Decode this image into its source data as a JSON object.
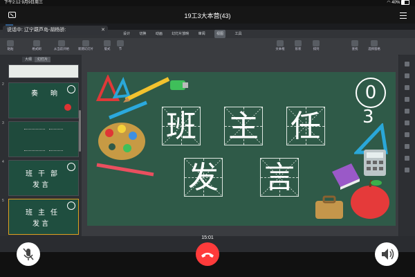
{
  "status_bar": {
    "time": "下午2:12",
    "date": "9月9日周三",
    "battery": "40%"
  },
  "call": {
    "title": "19工3大本营",
    "participants": "(43)",
    "timer": "15:01"
  },
  "speaker": {
    "label": "说话中:",
    "name": "辽宁葫芦岛-胡杨骄:"
  },
  "app": {
    "tabs": [
      "设计",
      "切换",
      "动画",
      "幻灯片放映",
      "审阅",
      "视图",
      "工具"
    ],
    "toolbar": [
      "粘贴",
      "格式刷",
      "从当前开始",
      "新建幻灯片",
      "版式",
      "节",
      "文本框",
      "形状",
      "排列",
      "查找",
      "选择窗格"
    ]
  },
  "panel": {
    "tabs": [
      "大纲",
      "幻灯片"
    ],
    "slide_numbers": [
      "2",
      "3",
      "4",
      "5"
    ]
  },
  "slide": {
    "line1": [
      "班",
      "主",
      "任"
    ],
    "line2": [
      "发",
      "言"
    ],
    "badge_digits": [
      "0",
      "3"
    ]
  },
  "thumbs": {
    "thumb2_line1": [
      "奏",
      "晌"
    ],
    "thumb4_line1": [
      "班",
      "干",
      "部"
    ],
    "thumb4_line2": "发 言",
    "thumb5_line1": [
      "班",
      "主",
      "任"
    ],
    "thumb5_line2": "发 言"
  },
  "colors": {
    "slide_bg": "#2f5a48",
    "hangup": "#ff3b3b",
    "selected_border": "#e0a020"
  }
}
